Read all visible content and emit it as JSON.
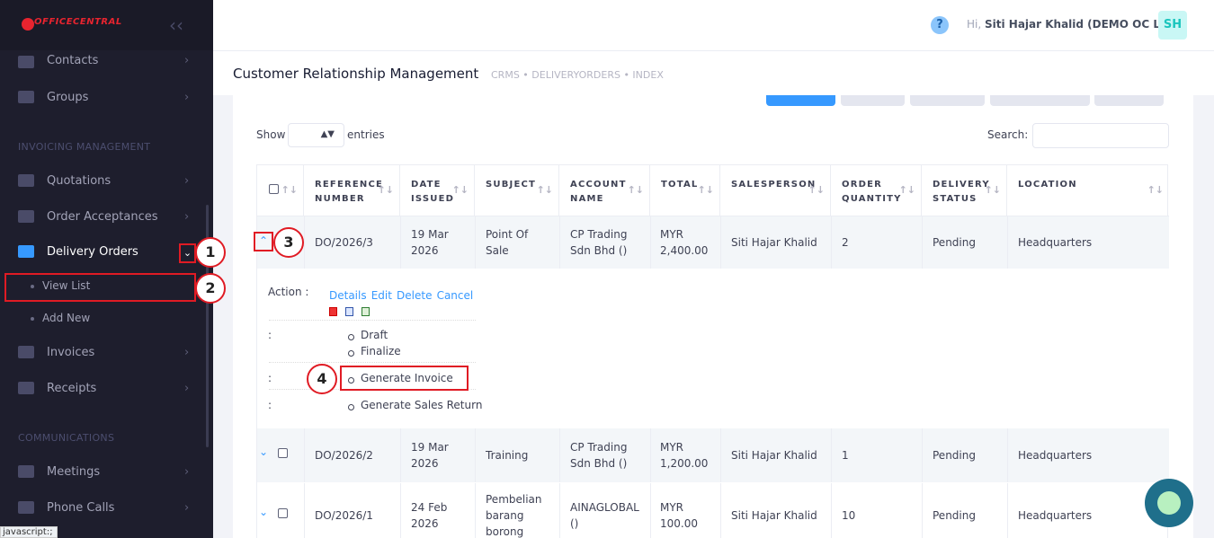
{
  "brand": {
    "logo_text": "OFFICECENTRAL",
    "collapse_icon": "double-chevron-left-icon"
  },
  "sidebar": {
    "items_top": [
      {
        "label": "Contacts",
        "icon": "contacts-icon"
      },
      {
        "label": "Groups",
        "icon": "groups-icon"
      }
    ],
    "section_invoicing": "INVOICING MANAGEMENT",
    "items_invoicing": [
      {
        "label": "Quotations",
        "icon": "quotations-icon"
      },
      {
        "label": "Order Acceptances",
        "icon": "order-acceptance-icon"
      },
      {
        "label": "Delivery Orders",
        "icon": "delivery-orders-icon",
        "active": true
      }
    ],
    "sub_items": [
      {
        "label": "View List"
      },
      {
        "label": "Add New"
      }
    ],
    "items_invoicing_2": [
      {
        "label": "Invoices",
        "icon": "invoices-icon"
      },
      {
        "label": "Receipts",
        "icon": "receipts-icon"
      }
    ],
    "section_comms": "COMMUNICATIONS",
    "items_comms": [
      {
        "label": "Meetings",
        "icon": "meetings-icon"
      },
      {
        "label": "Phone Calls",
        "icon": "phone-calls-icon"
      }
    ]
  },
  "header": {
    "help": "?",
    "greeting": "Hi,",
    "user": "Siti Hajar Khalid (DEMO OC LITE)",
    "avatar": "SH"
  },
  "subheader": {
    "title": "Customer Relationship Management",
    "breadcrumb": "CRMS  •  DELIVERYORDERS  •  INDEX"
  },
  "table_controls": {
    "show": "Show",
    "entries": "entries",
    "search": "Search:"
  },
  "columns": [
    "REFERENCE NUMBER",
    "DATE ISSUED",
    "SUBJECT",
    "ACCOUNT NAME",
    "TOTAL",
    "SALESPERSON",
    "ORDER QUANTITY",
    "DELIVERY STATUS",
    "LOCATION"
  ],
  "rows": [
    {
      "ref": "DO/2026/3",
      "date": "19 Mar 2026",
      "subject": "Point Of Sale",
      "account": "CP Trading Sdn Bhd ()",
      "total": "MYR 2,400.00",
      "salesperson": "Siti Hajar Khalid",
      "qty": "2",
      "status": "Pending",
      "location": "Headquarters"
    },
    {
      "ref": "DO/2026/2",
      "date": "19 Mar 2026",
      "subject": "Training",
      "account": "CP Trading Sdn Bhd ()",
      "total": "MYR 1,200.00",
      "salesperson": "Siti Hajar Khalid",
      "qty": "1",
      "status": "Pending",
      "location": "Headquarters"
    },
    {
      "ref": "DO/2026/1",
      "date": "24 Feb 2026",
      "subject": "Pembelian barang borong",
      "account": "AINAGLOBAL ()",
      "total": "MYR 100.00",
      "salesperson": "Siti Hajar Khalid",
      "qty": "10",
      "status": "Pending",
      "location": "Headquarters"
    }
  ],
  "detail": {
    "action_label": "Action :",
    "actions": [
      "Details",
      "Edit",
      "Delete",
      "Cancel"
    ],
    "colon": ":",
    "status_draft": "Draft",
    "finalize": "Finalize",
    "generate_invoice": "Generate Invoice",
    "generate_sales_return": "Generate Sales Return"
  },
  "callouts": [
    "1",
    "2",
    "3",
    "4"
  ],
  "statusbar": "javascript:;"
}
